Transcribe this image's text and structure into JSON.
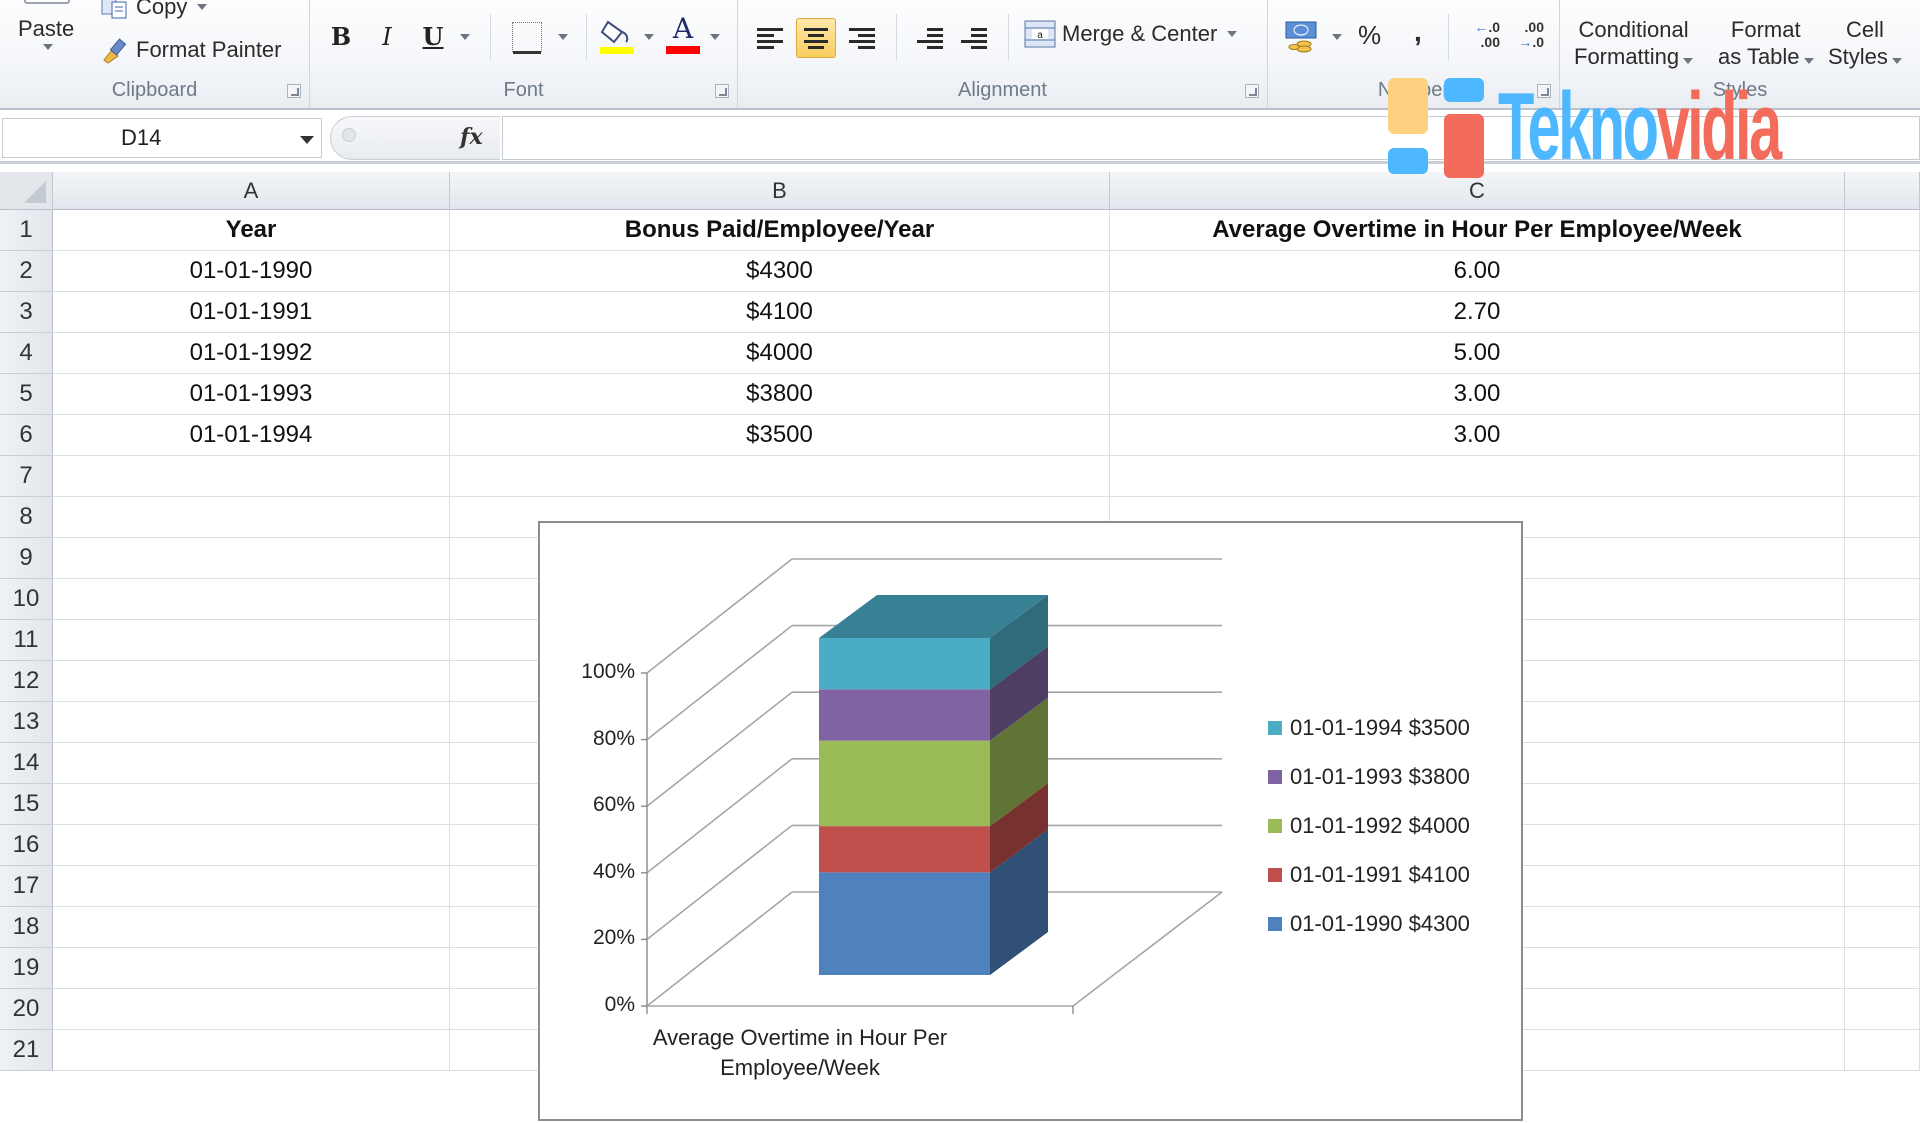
{
  "ribbon": {
    "clipboard": {
      "label": "Clipboard",
      "paste": "Paste",
      "copy": "Copy",
      "format_painter": "Format Painter"
    },
    "font": {
      "label": "Font",
      "bold": "B",
      "italic": "I",
      "underline": "U",
      "font_color_glyph": "A",
      "fill_color": "#ffff00",
      "font_color": "#ff0000"
    },
    "alignment": {
      "label": "Alignment",
      "merge_center": "Merge & Center",
      "active_alignment": "center"
    },
    "number": {
      "label": "Number",
      "percent": "%",
      "comma": ",",
      "increase_decimal": "←.0 .00",
      "decrease_decimal": ".00 →.0"
    },
    "styles": {
      "label": "Styles",
      "conditional_formatting": [
        "Conditional",
        "Formatting"
      ],
      "format_as_table": [
        "Format",
        "as Table"
      ],
      "cell_styles": [
        "Cell",
        "Styles"
      ]
    }
  },
  "formula_bar": {
    "name_box": "D14",
    "fx": "fx",
    "formula": ""
  },
  "sheet": {
    "columns": [
      "A",
      "B",
      "C"
    ],
    "rows": [
      "1",
      "2",
      "3",
      "4",
      "5",
      "6",
      "7",
      "8",
      "9",
      "10",
      "11",
      "12",
      "13",
      "14",
      "15",
      "16",
      "17",
      "18",
      "19",
      "20",
      "21"
    ],
    "headers": [
      "Year",
      "Bonus Paid/Employee/Year",
      "Average Overtime in Hour Per Employee/Week"
    ],
    "data": [
      [
        "01-01-1990",
        "$4300",
        "6.00"
      ],
      [
        "01-01-1991",
        "$4100",
        "2.70"
      ],
      [
        "01-01-1992",
        "$4000",
        "5.00"
      ],
      [
        "01-01-1993",
        "$3800",
        "3.00"
      ],
      [
        "01-01-1994",
        "$3500",
        "3.00"
      ]
    ]
  },
  "chart_data": {
    "type": "bar",
    "subtype": "3d-100%-stacked-column",
    "categories": [
      "Average Overtime in Hour Per Employee/Week"
    ],
    "series": [
      {
        "name": "01-01-1990 $4300",
        "values": [
          6.0
        ],
        "color": "#4f81bd"
      },
      {
        "name": "01-01-1991 $4100",
        "values": [
          2.7
        ],
        "color": "#c0504d"
      },
      {
        "name": "01-01-1992 $4000",
        "values": [
          5.0
        ],
        "color": "#9bbb59"
      },
      {
        "name": "01-01-1993 $3800",
        "values": [
          3.0
        ],
        "color": "#8064a2"
      },
      {
        "name": "01-01-1994 $3500",
        "values": [
          3.0
        ],
        "color": "#4bacc6"
      }
    ],
    "y_ticks": [
      "0%",
      "20%",
      "40%",
      "60%",
      "80%",
      "100%"
    ],
    "ylim": [
      0,
      100
    ],
    "yunit": "%",
    "grid": true,
    "legend": "right",
    "xlabel_lines": [
      "Average Overtime in Hour Per",
      "Employee/Week"
    ]
  },
  "watermark": {
    "part1": "Tekno",
    "part2": "vidia",
    "color1": "#4db8ff",
    "color2": "#f26b5b",
    "block_colors": [
      "#ffd080",
      "#4db8ff",
      "#f26b5b"
    ]
  }
}
